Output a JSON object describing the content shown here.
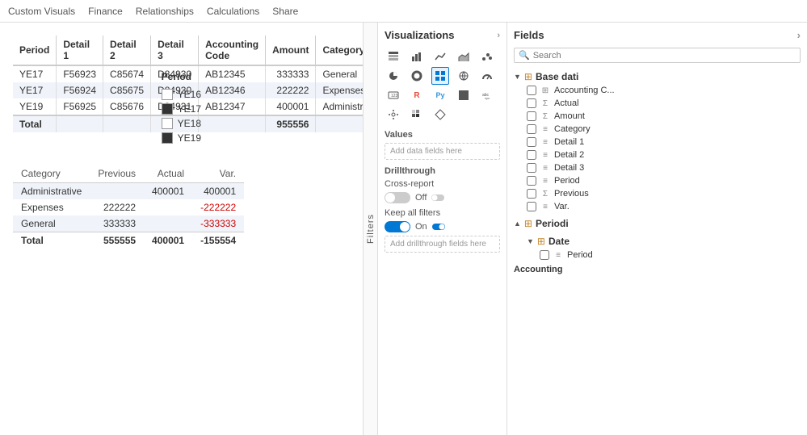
{
  "topnav": {
    "items": [
      "Custom Visuals",
      "Finance",
      "Relationships",
      "Calculations",
      "Share"
    ]
  },
  "main_table": {
    "headers": [
      "Period",
      "Detail 1",
      "Detail 2",
      "Detail 3",
      "Accounting Code",
      "Amount",
      "Category"
    ],
    "rows": [
      {
        "period": "YE17",
        "detail1": "F56923",
        "detail2": "C85674",
        "detail3": "D84930",
        "code": "AB12345",
        "amount": "333333",
        "category": "General",
        "highlight": false
      },
      {
        "period": "YE17",
        "detail1": "F56924",
        "detail2": "C85675",
        "detail3": "D84930",
        "code": "AB12346",
        "amount": "222222",
        "category": "Expenses",
        "highlight": true
      },
      {
        "period": "YE19",
        "detail1": "F56925",
        "detail2": "C85676",
        "detail3": "D84931",
        "code": "AB12347",
        "amount": "400001",
        "category": "Administrative",
        "highlight": false
      }
    ],
    "total_label": "Total",
    "total_amount": "955556"
  },
  "period_legend": {
    "title": "Period",
    "items": [
      {
        "label": "YE16",
        "filled": false
      },
      {
        "label": "YE17",
        "filled": true
      },
      {
        "label": "YE18",
        "filled": false
      },
      {
        "label": "YE19",
        "filled": true
      }
    ]
  },
  "summary_table": {
    "col_category": "Category",
    "col_previous": "Previous",
    "col_actual": "Actual",
    "col_var": "Var.",
    "rows": [
      {
        "category": "Administrative",
        "previous": "",
        "actual": "400001",
        "var": "400001",
        "var_negative": false
      },
      {
        "category": "Expenses",
        "previous": "222222",
        "actual": "",
        "var": "-222222",
        "var_negative": true
      },
      {
        "category": "General",
        "previous": "333333",
        "actual": "",
        "var": "-333333",
        "var_negative": true
      }
    ],
    "total_label": "Total",
    "total_previous": "555555",
    "total_actual": "400001",
    "total_var": "-155554",
    "total_var_negative": true
  },
  "viz_panel": {
    "title": "Visualizations",
    "arrow": "›",
    "icons": [
      "≡",
      "📊",
      "📈",
      "📉",
      "⬜",
      "🔵",
      "◉",
      "🔘",
      "📋",
      "≣",
      "🗺",
      "🔲",
      "🌀",
      "🅁",
      "Py",
      "⬛",
      "☁",
      "⚙",
      "▦",
      "🔷"
    ],
    "values_label": "Values",
    "add_data_label": "Add data fields here",
    "drillthrough_label": "Drillthrough",
    "cross_report_label": "Cross-report",
    "toggle_off_label": "Off",
    "keep_filters_label": "Keep all filters",
    "toggle_on_label": "On",
    "add_drillthrough_label": "Add drillthrough fields here"
  },
  "fields_panel": {
    "title": "Fields",
    "arrow": "›",
    "search_placeholder": "Search",
    "base_dati_label": "Base dati",
    "base_dati_fields": [
      {
        "label": "Accounting C...",
        "type": "db",
        "checked": false
      },
      {
        "label": "Actual",
        "type": "db-sigma",
        "checked": false
      },
      {
        "label": "Amount",
        "type": "sigma",
        "checked": false
      },
      {
        "label": "Category",
        "type": "text",
        "checked": false
      },
      {
        "label": "Detail 1",
        "type": "text",
        "checked": false
      },
      {
        "label": "Detail 2",
        "type": "text",
        "checked": false
      },
      {
        "label": "Detail 3",
        "type": "text",
        "checked": false
      },
      {
        "label": "Period",
        "type": "text",
        "checked": false
      },
      {
        "label": "Previous",
        "type": "db-sigma",
        "checked": false
      },
      {
        "label": "Var.",
        "type": "text",
        "checked": false
      }
    ],
    "periodi_label": "Periodi",
    "date_label": "Date",
    "date_period_label": "Period",
    "accounting_label": "Accounting"
  }
}
